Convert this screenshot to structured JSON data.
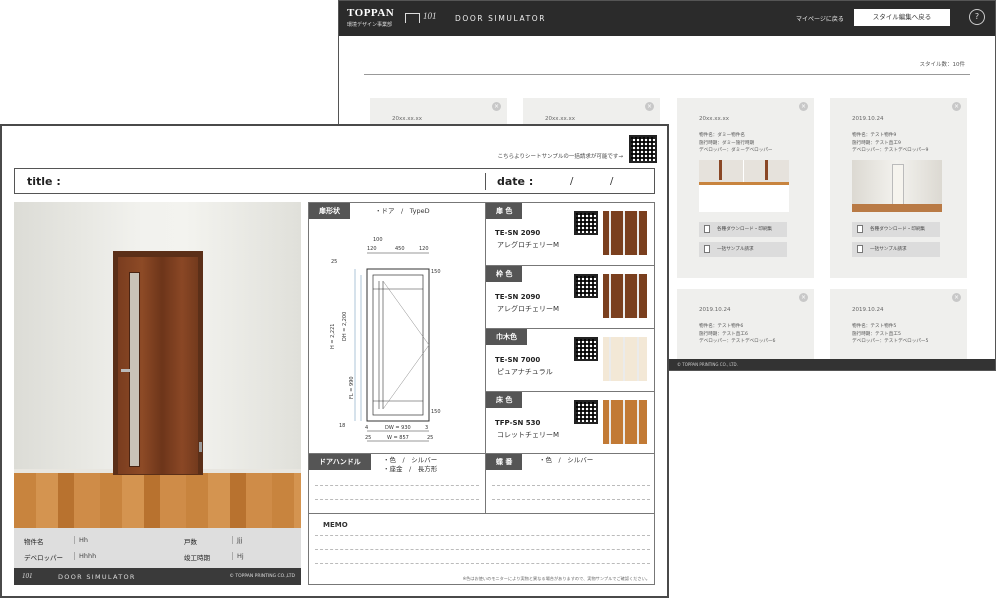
{
  "back_window": {
    "logo": "TOPPAN",
    "logo_sub": "環境デザイン事業部",
    "brand": "101",
    "app_title": "DOOR SIMULATOR",
    "mypage_link": "マイページに戻る",
    "edit_button": "スタイル編集へ戻る",
    "help": "?",
    "style_count": "スタイル数：10件",
    "footer_text": "© TOPPAN PRINTING CO., LTD.",
    "cards": [
      {
        "date": "20xx.xx.xx",
        "lines": []
      },
      {
        "date": "20xx.xx.xx",
        "lines": []
      },
      {
        "date": "20xx.xx.xx",
        "lines": [
          "物件名：ダミー物件名",
          "施行時期：ダミー施行時期",
          "デベロッパー：ダミーデベロッパー"
        ],
        "btn1": "各種ダウンロード・印刷集",
        "btn2": "一括サンプル請求"
      },
      {
        "date": "2019.10.24",
        "lines": [
          "物件名：テスト物件9",
          "施行時期：テスト直工9",
          "デベロッパー：テストデベロッパー9"
        ],
        "btn1": "各種ダウンロード・印刷集",
        "btn2": "一括サンプル請求"
      },
      {
        "date": "2019.10.24",
        "lines": [
          "物件名：テスト物件6",
          "施行時期：テスト直工6",
          "デベロッパー：テストデベロッパー6"
        ]
      },
      {
        "date": "2019.10.24",
        "lines": [
          "物件名：テスト物件5",
          "施行時期：テスト直工5",
          "デベロッパー：テストデベロッパー5"
        ]
      }
    ]
  },
  "sheet": {
    "note": "こちらよりシートサンプルの一括請求が可能です→",
    "title_label": "title :",
    "date_label": "date :",
    "date_sep": "/",
    "info": {
      "property_label": "物件名",
      "property_value": "Hh",
      "units_label": "戸数",
      "units_value": "Jjj",
      "developer_label": "デベロッパー",
      "developer_value": "Hhhh",
      "completion_label": "竣工時期",
      "completion_value": "Hj"
    },
    "brandbar": {
      "brand": "101",
      "title": "DOOR SIMULATOR",
      "copyright": "© TOPPAN PRINTING CO.,LTD"
    },
    "door_shape": {
      "label": "扉形状",
      "value": "・ドア　/　TypeD"
    },
    "dimensions": {
      "top": [
        "100",
        "120",
        "450",
        "120"
      ],
      "h_total": "H = 2,221",
      "dh": "DH = 2,200",
      "fl": "FL = 990",
      "bottom1": [
        "4",
        "DW = 930",
        "3"
      ],
      "bottom2": [
        "25",
        "W = 857",
        "25"
      ],
      "side_top": "25",
      "side_r1": "150",
      "side_r2": "150",
      "side_b": "18"
    },
    "materials": [
      {
        "label": "扉 色",
        "code": "TE-SN 2090",
        "name": "アレグロチェリーM",
        "color": "#7a3f1e"
      },
      {
        "label": "枠 色",
        "code": "TE-SN 2090",
        "name": "アレグロチェリーM",
        "color": "#7a3f1e"
      },
      {
        "label": "巾木色",
        "code": "TE-SN 7000",
        "name": "ピュアナチュラル",
        "color": "#f3e8d6"
      },
      {
        "label": "床 色",
        "code": "TFP-SN 530",
        "name": "コレットチェリーM",
        "color": "#c27a35"
      }
    ],
    "handle": {
      "label": "ドアハンドル",
      "opt1": "・色　/　シルバー",
      "opt2": "・座金　/　長方形"
    },
    "hinge": {
      "label": "蝶 番",
      "opt1": "・色　/　シルバー"
    },
    "memo_label": "MEMO",
    "fine_print": "※色はお使いのモニターにより実物と異なる場合がありますので、実物サンプルでご確認ください。"
  }
}
